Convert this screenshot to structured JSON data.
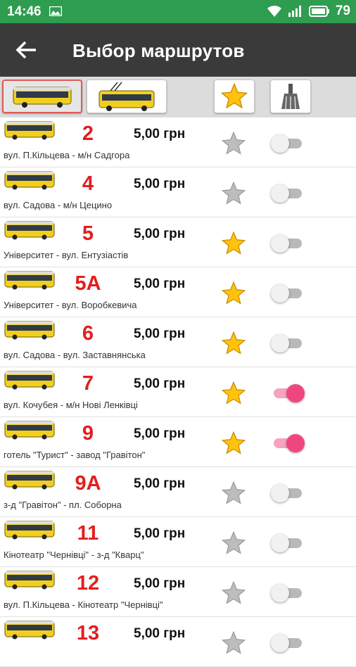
{
  "status_bar": {
    "time": "14:46",
    "battery": "79"
  },
  "app_bar": {
    "title": "Выбор маршрутов"
  },
  "tabs": [
    {
      "name": "bus",
      "selected": true
    },
    {
      "name": "trolleybus",
      "selected": false
    },
    {
      "name": "favorites",
      "selected": false
    },
    {
      "name": "clear",
      "selected": false
    }
  ],
  "colors": {
    "status_bar": "#2e9d50",
    "app_bar": "#3a3a3a",
    "route_number": "#e31e1e",
    "toggle_on": "#f0467f",
    "star_on": "#ffc20e",
    "star_off": "#bdbdbd"
  },
  "routes": [
    {
      "number": "2",
      "price": "5,00  грн",
      "desc": "вул. П.Кільцева - м/н Садгора",
      "favorite": false,
      "enabled": false
    },
    {
      "number": "4",
      "price": "5,00  грн",
      "desc": "вул. Садова - м/н Цецино",
      "favorite": false,
      "enabled": false
    },
    {
      "number": "5",
      "price": "5,00  грн",
      "desc": "Університет - вул. Ентузіастів",
      "favorite": true,
      "enabled": false
    },
    {
      "number": "5A",
      "price": "5,00  грн",
      "desc": "Університет - вул. Воробкевича",
      "favorite": true,
      "enabled": false
    },
    {
      "number": "6",
      "price": "5,00  грн",
      "desc": "вул. Садова - вул. Заставнянська",
      "favorite": true,
      "enabled": false
    },
    {
      "number": "7",
      "price": "5,00  грн",
      "desc": "вул. Кочубея - м/н Нові Ленківці",
      "favorite": true,
      "enabled": true
    },
    {
      "number": "9",
      "price": "5,00  грн",
      "desc": "готель \"Турист\" - завод \"Гравітон\"",
      "favorite": true,
      "enabled": true
    },
    {
      "number": "9A",
      "price": "5,00  грн",
      "desc": "з-д \"Гравітон\" - пл. Соборна",
      "favorite": false,
      "enabled": false
    },
    {
      "number": "11",
      "price": "5,00  грн",
      "desc": "Кінотеатр \"Чернівці\" - з-д \"Кварц\"",
      "favorite": false,
      "enabled": false
    },
    {
      "number": "12",
      "price": "5,00  грн",
      "desc": "вул. П.Кільцева - Кінотеатр \"Чернівці\"",
      "favorite": false,
      "enabled": false
    },
    {
      "number": "13",
      "price": "5,00  грн",
      "desc": "",
      "favorite": false,
      "enabled": false
    }
  ]
}
